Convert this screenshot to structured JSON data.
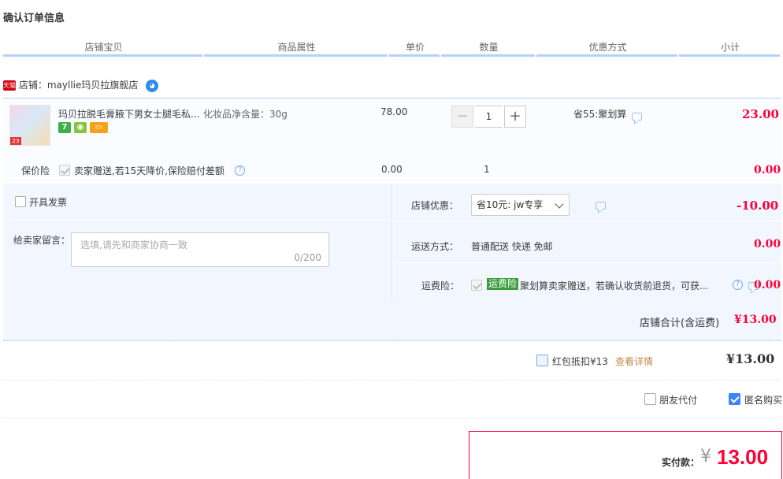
{
  "page": {
    "title": "确认订单信息"
  },
  "table_headers": [
    "店铺宝贝",
    "商品属性",
    "单价",
    "数量",
    "优惠方式",
    "小计"
  ],
  "shop": {
    "badge": "天猫",
    "label": "店铺：",
    "name": "mayllie玛贝拉旗舰店",
    "chat_icon": "wangwang-chat-icon"
  },
  "item": {
    "thumb_tag": "23",
    "name": "玛贝拉脱毛膏腋下男女士腿毛私...",
    "attr": "化妆品净含量：30g",
    "price": "78.00",
    "quantity": "1",
    "qty_minus": "−",
    "qty_plus": "+",
    "promo": "省55:聚划算",
    "subtotal": "23.00",
    "badges": [
      {
        "text": "7",
        "color": "#3bb04a",
        "icon": "seven-day-return-icon"
      },
      {
        "text": "◉",
        "color": "#88c33f",
        "icon": "certified-icon"
      },
      {
        "text": "▭",
        "color": "#f3a21a",
        "icon": "card-payment-icon"
      }
    ]
  },
  "insurance": {
    "label": "保价险",
    "desc": "卖家赠送,若15天降价,保险赔付差额",
    "help": "?",
    "price": "0.00",
    "qty": "1",
    "subtotal": "0.00"
  },
  "invoice": {
    "label": "开具发票"
  },
  "message": {
    "label": "给卖家留言：",
    "placeholder": "选填,请先和商家协商一致",
    "count": "0/200"
  },
  "shop_discount": {
    "label": "店铺优惠：",
    "selected": "省10元: jw专享",
    "amount": "-10.00"
  },
  "shipping": {
    "label": "运送方式：",
    "value": "普通配送 快递 免邮",
    "amount": "0.00"
  },
  "shipping_insurance": {
    "label": "运费险：",
    "tag": "运费险",
    "desc": "聚划算卖家赠送，若确认收货前退货，可获...",
    "help": "?",
    "amount": "0.00"
  },
  "shop_total": {
    "label": "店铺合计(含运费)",
    "amount": "¥13.00"
  },
  "red_packet": {
    "label": "红包抵扣¥13",
    "link": "查看详情",
    "amount": "¥13.00"
  },
  "options": {
    "friend_pay": "朋友代付",
    "anonymous": "匿名购买"
  },
  "pay": {
    "label": "实付款：",
    "currency": "¥",
    "amount": "13.00"
  },
  "colors": {
    "accent_blue": "#b2d1ff",
    "price_red": "#ff0036",
    "panel_bg": "#f2f7ff"
  }
}
